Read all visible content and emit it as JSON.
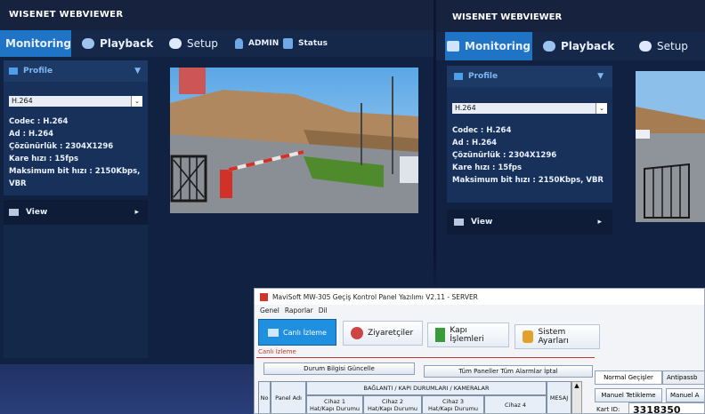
{
  "left": {
    "brand": "WISENET WEBVIEWER",
    "tabs": {
      "monitoring": "Monitoring",
      "playback": "Playback",
      "setup": "Setup"
    },
    "admin": "ADMIN",
    "status": "Status",
    "profile": "Profile",
    "codec_select": "H.264",
    "info": [
      "Codec : H.264",
      "Ad : H.264",
      "Çözünürlük : 2304X1296",
      "Kare hızı : 15fps",
      "Maksimum bit hızı : 2150Kbps, VBR"
    ],
    "view": "View"
  },
  "right": {
    "brand": "WISENET WEBVIEWER",
    "tabs": {
      "monitoring": "Monitoring",
      "playback": "Playback",
      "setup": "Setup"
    },
    "profile": "Profile",
    "codec_select": "H.264",
    "info": [
      "Codec : H.264",
      "Ad : H.264",
      "Çözünürlük : 2304X1296",
      "Kare hızı : 15fps",
      "Maksimum bit hızı : 2150Kbps, VBR"
    ],
    "view": "View"
  },
  "mavisoft": {
    "title": "MaviSoft MW-305 Geçiş Kontrol Panel Yazılımı V2.11 - SERVER",
    "menu": [
      "Genel",
      "Raporlar",
      "Dil"
    ],
    "buttons": [
      "Canlı İzleme",
      "Ziyaretçiler",
      "Kapı İşlemleri",
      "Sistem Ayarları"
    ],
    "section_label": "Canlı İzleme",
    "btn_status_update": "Durum Bilgisi Güncelle",
    "btn_cancel_alarms": "Tüm Paneller Tüm Alarmlar İptal",
    "table": {
      "no": "No",
      "panel_adi": "Panel Adı",
      "group_header": "BAĞLANTI / KAPI DURUMLARI / KAMERALAR",
      "mesaj": "MESAJ",
      "cihaz": [
        "Cihaz 1",
        "Cihaz 2",
        "Cihaz 3",
        "Cihaz 4"
      ],
      "sub": "Hat/Kapı Durumu"
    },
    "right_tabs": [
      "Normal Geçişler",
      "Antipassb"
    ],
    "right_buttons": [
      "Manuel Tetikleme",
      "Manuel A"
    ],
    "kart_label": "Kart ID:",
    "kart_value": "3318350"
  },
  "colors": {
    "accent": "#1f74c6",
    "frame": "#0f1d38"
  }
}
